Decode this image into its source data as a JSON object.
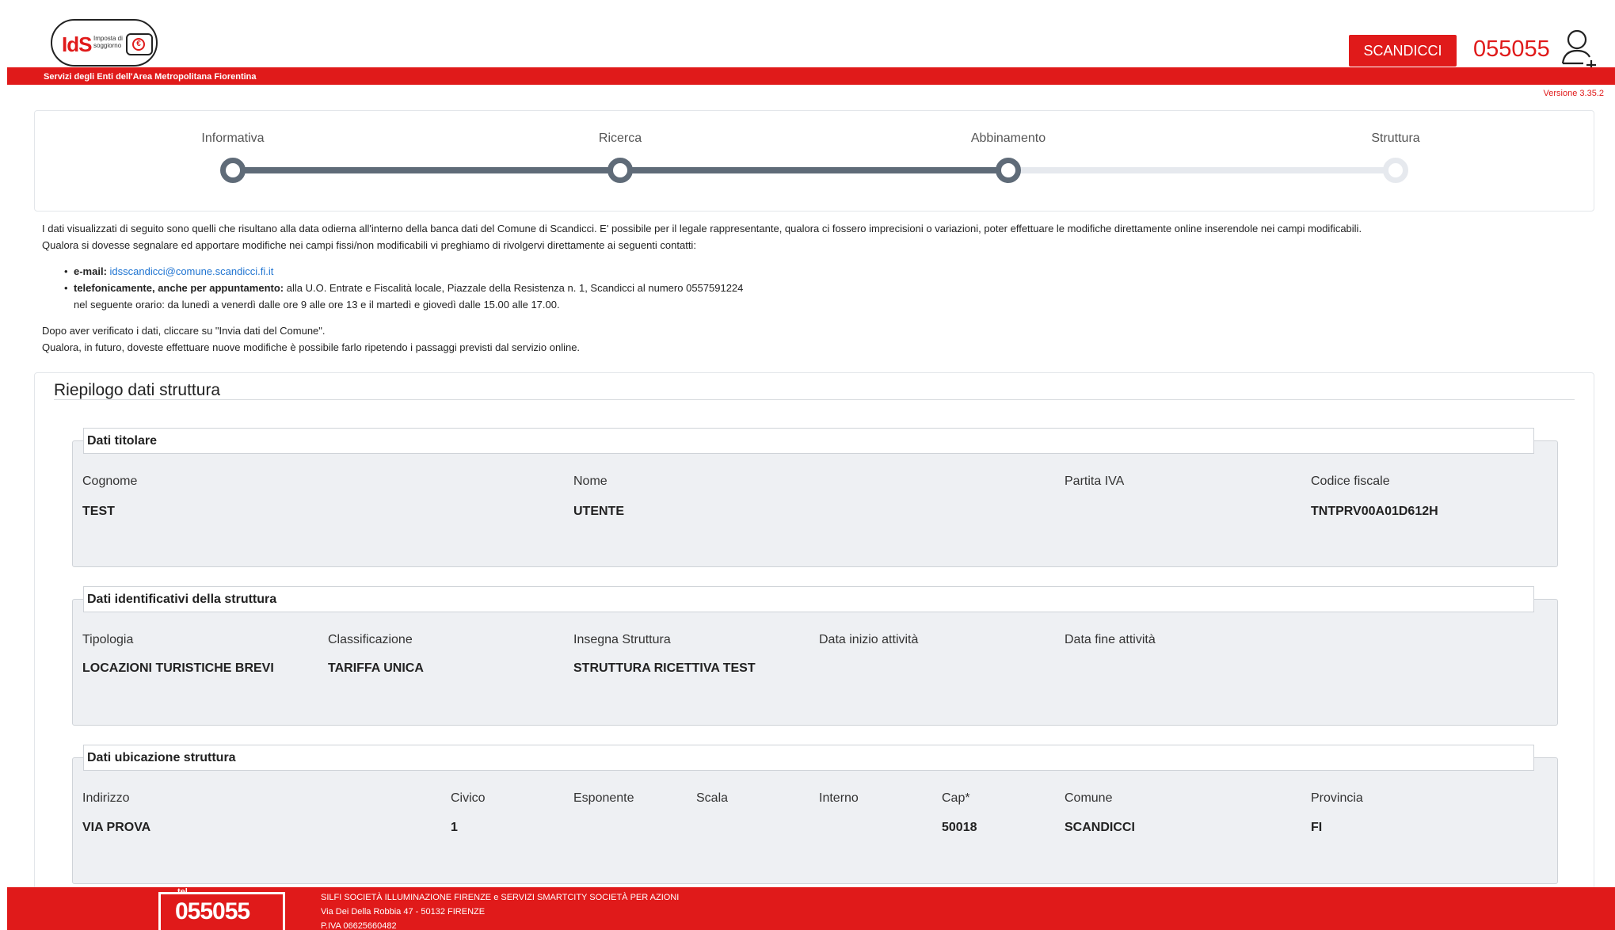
{
  "header": {
    "logo_text": "IdS",
    "logo_sub": "Imposta di soggiorno",
    "tagline": "Servizi degli Enti dell'Area Metropolitana Fiorentina",
    "comune_button": "SCANDICCI",
    "phone": "055055",
    "version": "Versione 3.35.2"
  },
  "steps": [
    {
      "label": "Informativa",
      "status": "done"
    },
    {
      "label": "Ricerca",
      "status": "done"
    },
    {
      "label": "Abbinamento",
      "status": "done"
    },
    {
      "label": "Struttura",
      "status": "todo"
    }
  ],
  "info": {
    "p1": "I dati visualizzati di seguito sono quelli che risultano alla data odierna all'interno della banca dati del Comune di Scandicci. E' possibile per il legale rappresentante, qualora ci fossero imprecisioni o variazioni, poter effettuare le modifiche direttamente online inserendole nei campi modificabili.",
    "p2": "Qualora si dovesse segnalare ed apportare modifiche nei campi fissi/non modificabili vi preghiamo di rivolgervi direttamente ai seguenti contatti:",
    "email_label": "e-mail:",
    "email": "idsscandicci@comune.scandicci.fi.it",
    "phone_label": "telefonicamente, anche per appuntamento:",
    "phone_text": "alla U.O. Entrate e Fiscalità locale, Piazzale della Resistenza n. 1, Scandicci al numero 0557591224",
    "hours": "nel seguente orario: da lunedì a venerdì dalle ore 9 alle ore 13 e il martedì e giovedì dalle 15.00 alle 17.00.",
    "p3": "Dopo aver verificato i dati, cliccare su \"Invia dati del Comune\".",
    "p4": "Qualora, in futuro, doveste effettuare nuove modifiche è possibile farlo ripetendo i passaggi previsti dal servizio online."
  },
  "summary": {
    "title": "Riepilogo dati struttura",
    "titolare": {
      "legend": "Dati titolare",
      "labels": {
        "cognome": "Cognome",
        "nome": "Nome",
        "piva": "Partita IVA",
        "cf": "Codice fiscale"
      },
      "values": {
        "cognome": "TEST",
        "nome": "UTENTE",
        "piva": "",
        "cf": "TNTPRV00A01D612H"
      }
    },
    "identificativi": {
      "legend": "Dati identificativi della struttura",
      "labels": {
        "tipologia": "Tipologia",
        "classificazione": "Classificazione",
        "insegna": "Insegna Struttura",
        "inizio": "Data inizio attività",
        "fine": "Data fine attività"
      },
      "values": {
        "tipologia": "LOCAZIONI TURISTICHE BREVI",
        "classificazione": "TARIFFA UNICA",
        "insegna": "STRUTTURA RICETTIVA TEST",
        "inizio": "",
        "fine": ""
      }
    },
    "ubicazione": {
      "legend": "Dati ubicazione struttura",
      "labels": {
        "indirizzo": "Indirizzo",
        "civico": "Civico",
        "esponente": "Esponente",
        "scala": "Scala",
        "interno": "Interno",
        "cap": "Cap*",
        "comune": "Comune",
        "provincia": "Provincia"
      },
      "values": {
        "indirizzo": "VIA PROVA",
        "civico": "1",
        "esponente": "",
        "scala": "",
        "interno": "",
        "cap": "50018",
        "comune": "SCANDICCI",
        "provincia": "FI"
      }
    }
  },
  "footer": {
    "tel_label": "tel",
    "phone": "055055",
    "company": "SILFI SOCIETÀ ILLUMINAZIONE FIRENZE e SERVIZI SMARTCITY SOCIETÀ PER AZIONI",
    "address": "Via Dei Della Robbia 47 - 50132 FIRENZE",
    "piva": "P.IVA 06625660482"
  }
}
